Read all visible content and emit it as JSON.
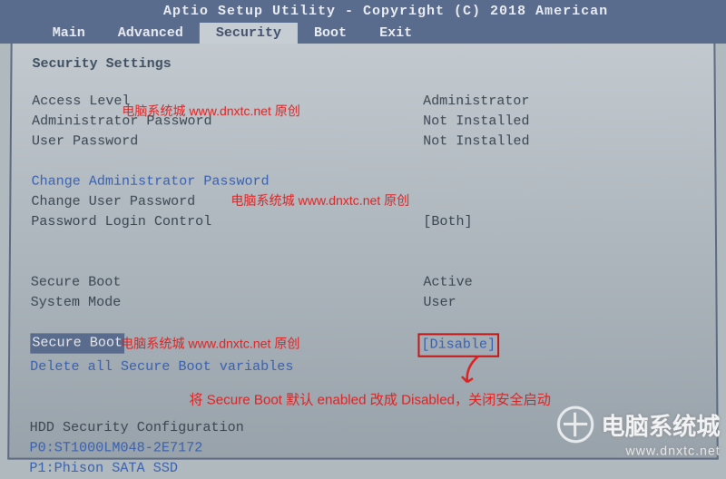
{
  "title": "Aptio Setup Utility - Copyright (C) 2018 American",
  "menu": {
    "items": [
      "Main",
      "Advanced",
      "Security",
      "Boot",
      "Exit"
    ],
    "active": "Security"
  },
  "section_title": "Security Settings",
  "rows": {
    "access_level": {
      "label": "Access Level",
      "value": "Administrator"
    },
    "admin_password": {
      "label": "Administrator Password",
      "value": "Not Installed"
    },
    "user_password": {
      "label": "User Password",
      "value": "Not Installed"
    },
    "change_admin": {
      "label": "Change Administrator Password"
    },
    "change_user": {
      "label": "Change User Password"
    },
    "login_control": {
      "label": "Password Login Control",
      "value": "[Both]"
    },
    "secure_boot_state": {
      "label": "Secure Boot",
      "value": "Active"
    },
    "system_mode": {
      "label": "System Mode",
      "value": "User"
    },
    "secure_boot": {
      "label": "Secure Boot",
      "value": "[Disable]"
    },
    "delete_vars": {
      "label": "Delete all Secure Boot variables"
    },
    "hdd_cfg": {
      "label": "HDD Security Configuration"
    },
    "hdd0": {
      "label": "P0:ST1000LM048-2E7172"
    },
    "hdd1": {
      "label": "P1:Phison SATA SSD"
    }
  },
  "watermark": "电脑系统城 www.dnxtc.net 原创",
  "annotation": "将 Secure Boot 默认 enabled 改成 Disabled，关闭安全启动",
  "site_logo": {
    "name": "电脑系统城",
    "url": "www.dnxtc.net"
  }
}
